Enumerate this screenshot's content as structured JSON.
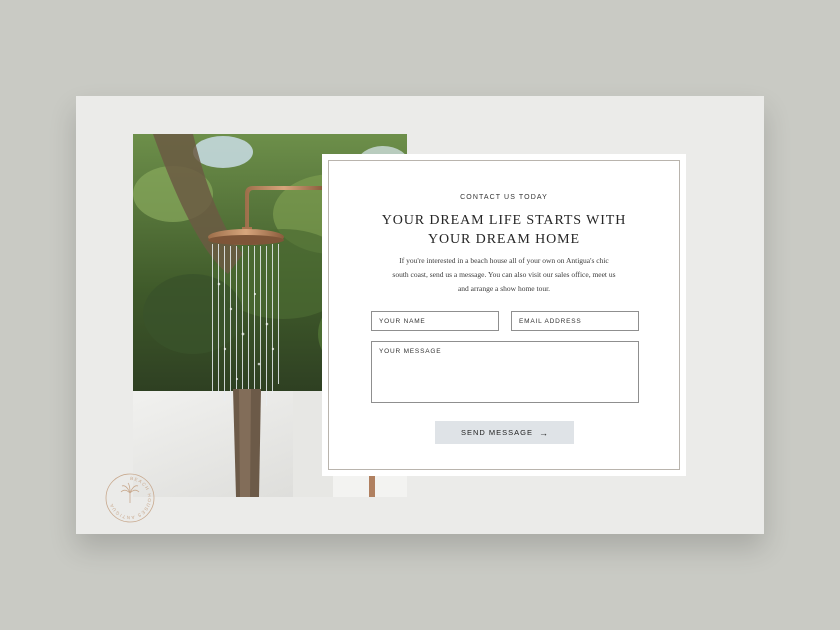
{
  "form": {
    "eyebrow": "CONTACT US TODAY",
    "headline": [
      "YOUR DREAM LIFE STARTS WITH",
      "YOUR DREAM HOME"
    ],
    "intro": "If you're interested in a beach house all of your own on Antigua's chic south coast, send us a message. You can also visit our sales office, meet us and arrange a show home tour.",
    "fields": {
      "name_placeholder": "YOUR NAME",
      "email_placeholder": "EMAIL ADDRESS",
      "message_placeholder": "YOUR MESSAGE"
    },
    "send_label": "SEND MESSAGE",
    "send_arrow": "→"
  },
  "badge": {
    "text": "BEACH HOUSES ANTIGUA"
  },
  "colors": {
    "background": "#c9cac4",
    "card": "#ebebe9",
    "button": "#dfe3e7",
    "badge": "#c8a98e"
  }
}
